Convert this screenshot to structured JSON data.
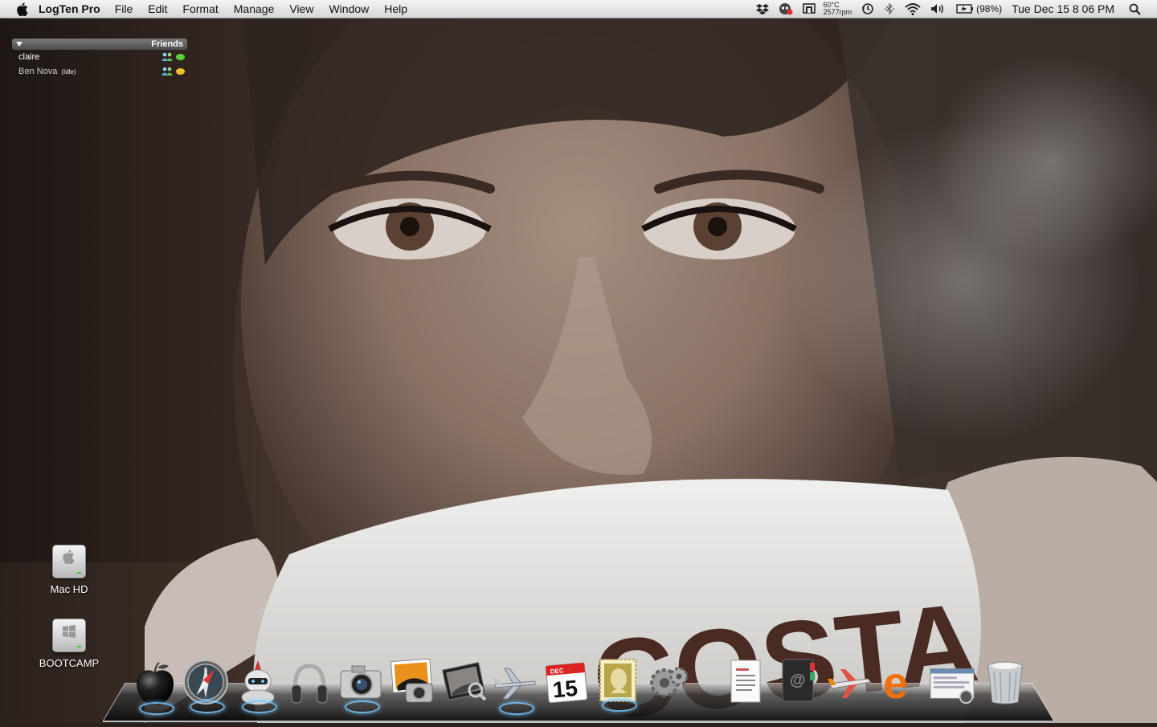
{
  "menubar": {
    "app_name": "LogTen Pro",
    "menus": [
      "File",
      "Edit",
      "Format",
      "Manage",
      "View",
      "Window",
      "Help"
    ],
    "status": {
      "temperature": "60°C",
      "fan_speed": "2577rpm",
      "battery_percent": "(98%)",
      "clock": "Tue Dec 15  8 06 PM",
      "icons": [
        "dropbox-icon",
        "growl-icon",
        "monitor-icon",
        "temperature-readout",
        "time-machine-icon",
        "bluetooth-icon",
        "wifi-icon",
        "volume-icon",
        "battery-icon",
        "spotlight-icon"
      ]
    }
  },
  "friends_widget": {
    "header": "Friends",
    "buddies": [
      {
        "name": "claire",
        "status": "",
        "status_color": "#5ccf35"
      },
      {
        "name": "Ben Nova",
        "status": "(Idle)",
        "status_color": "#f0c030"
      }
    ]
  },
  "desktop_icons": [
    {
      "label": "Mac HD",
      "icon": "hard-drive-icon"
    },
    {
      "label": "BOOTCAMP",
      "icon": "windows-drive-icon"
    }
  ],
  "dock": {
    "items": [
      {
        "name": "finder-apple",
        "icon": "black-apple-icon",
        "running": true
      },
      {
        "name": "safari",
        "icon": "safari-compass-icon",
        "running": true
      },
      {
        "name": "adium",
        "icon": "robot-duck-icon",
        "running": true
      },
      {
        "name": "itunes",
        "icon": "headphones-icon",
        "running": false
      },
      {
        "name": "image-capture",
        "icon": "camera-icon",
        "running": true
      },
      {
        "name": "iphoto",
        "icon": "iphoto-icon",
        "running": false
      },
      {
        "name": "preview",
        "icon": "photo-viewer-icon",
        "running": false
      },
      {
        "name": "logten-pro",
        "icon": "airplane-icon",
        "running": true
      },
      {
        "name": "ical",
        "icon": "calendar-icon",
        "month": "DEC",
        "day": "15",
        "running": false
      },
      {
        "name": "stamp",
        "icon": "postage-stamp-icon",
        "running": true
      },
      {
        "name": "system-preferences",
        "icon": "gears-icon",
        "running": false
      },
      {
        "name": "text-document",
        "icon": "document-icon",
        "running": false
      },
      {
        "name": "address-book",
        "icon": "address-book-icon",
        "running": false
      },
      {
        "name": "airplane-app",
        "icon": "jet-icon",
        "running": false
      },
      {
        "name": "e-app",
        "icon": "orange-e-icon",
        "running": false
      },
      {
        "name": "screenshot-doc",
        "icon": "screenshot-icon",
        "running": false
      },
      {
        "name": "trash",
        "icon": "trash-icon",
        "running": false
      }
    ]
  },
  "wallpaper": {
    "cup_text": "COSTA"
  },
  "colors": {
    "menubar": "#e3e3e3",
    "run_indicator": "#78c8ff",
    "cup_text": "#4a2b24"
  }
}
